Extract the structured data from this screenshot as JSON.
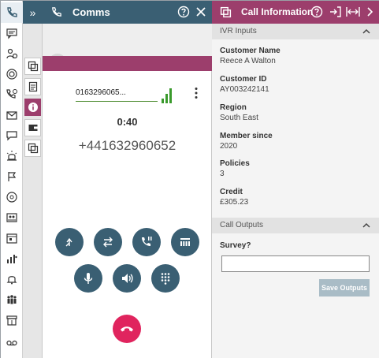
{
  "comms": {
    "title": "Comms",
    "dialed_number": "0163296065...",
    "timer": "0:40",
    "phone_number": "+441632960652"
  },
  "call_info": {
    "title": "Call Information",
    "ivr_section": "IVR Inputs",
    "fields": [
      {
        "label": "Customer Name",
        "value": "Reece A Walton"
      },
      {
        "label": "Customer ID",
        "value": "AY003242141"
      },
      {
        "label": "Region",
        "value": "South East"
      },
      {
        "label": "Member since",
        "value": "2020"
      },
      {
        "label": "Policies",
        "value": "3"
      },
      {
        "label": "Credit",
        "value": "£305.23"
      }
    ],
    "outputs_section": "Call Outputs",
    "survey_label": "Survey?",
    "survey_value": "",
    "save_label": "Save Outputs"
  },
  "colors": {
    "teal": "#3a5f73",
    "magenta": "#9c3e6c",
    "hangup": "#e0245e",
    "signal": "#3a9a2c"
  }
}
